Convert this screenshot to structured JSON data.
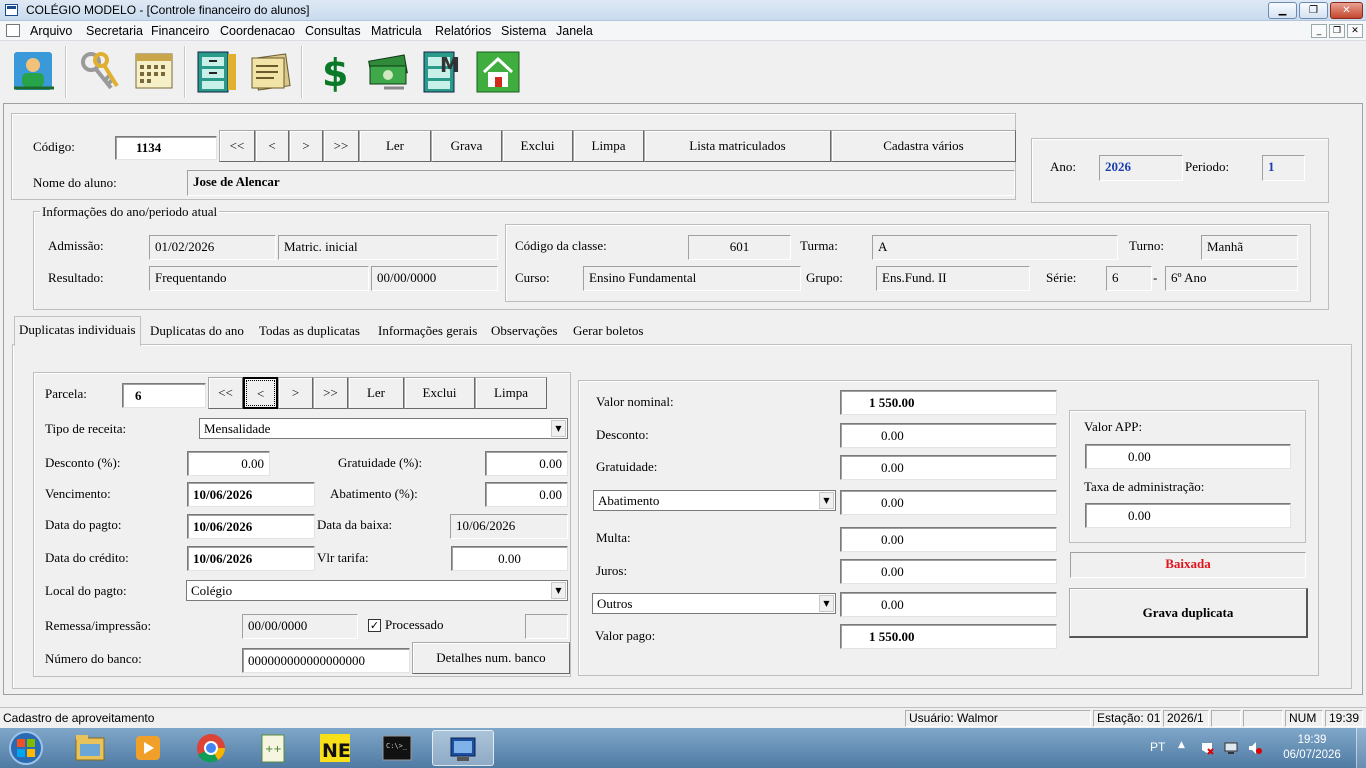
{
  "window": {
    "title": "COLÉGIO MODELO - [Controle financeiro do alunos]"
  },
  "menu": [
    "Arquivo",
    "Secretaria",
    "Financeiro",
    "Coordenacao",
    "Consultas",
    "Matricula",
    "Relatórios",
    "Sistema",
    "Janela"
  ],
  "student": {
    "codigo_label": "Código:",
    "codigo": "1134",
    "nav": [
      "<<",
      "<",
      ">",
      ">>"
    ],
    "actions": [
      "Ler",
      "Grava",
      "Exclui",
      "Limpa",
      "Lista matriculados",
      "Cadastra vários"
    ],
    "nome_label": "Nome do aluno:",
    "nome": "Jose de Alencar",
    "ano_label": "Ano:",
    "ano": "2026",
    "periodo_label": "Periodo:",
    "periodo": "1"
  },
  "ano_info": {
    "title": "Informações do ano/periodo atual",
    "admissao_label": "Admissão:",
    "admissao": "01/02/2026",
    "matric": "Matric. inicial",
    "resultado_label": "Resultado:",
    "resultado": "Frequentando",
    "resultado_data": "00/00/0000",
    "classe_label": "Código da classe:",
    "classe": "601",
    "turma_label": "Turma:",
    "turma": "A",
    "turno_label": "Turno:",
    "turno": "Manhã",
    "curso_label": "Curso:",
    "curso": "Ensino Fundamental",
    "grupo_label": "Grupo:",
    "grupo": "Ens.Fund. II",
    "serie_label": "Série:",
    "serie": "6",
    "serie_dash": "-",
    "serie_nome": "6º Ano"
  },
  "tabs": [
    "Duplicatas individuais",
    "Duplicatas do ano",
    "Todas as duplicatas",
    "Informações gerais",
    "Observações",
    "Gerar boletos"
  ],
  "dup": {
    "parcela_label": "Parcela:",
    "parcela": "6",
    "nav": [
      "<<",
      "<",
      ">",
      ">>"
    ],
    "actions": [
      "Ler",
      "Exclui",
      "Limpa"
    ],
    "tipo_label": "Tipo de receita:",
    "tipo": "Mensalidade",
    "desconto_label": "Desconto (%):",
    "desconto": "0.00",
    "gratuidade_label": "Gratuidade (%):",
    "gratuidade": "0.00",
    "vencimento_label": "Vencimento:",
    "vencimento": "10/06/2026",
    "abatimento_label": "Abatimento (%):",
    "abatimento": "0.00",
    "pagto_label": "Data do pagto:",
    "pagto": "10/06/2026",
    "baixa_label": "Data da baixa:",
    "baixa": "10/06/2026",
    "credito_label": "Data do crédito:",
    "credito": "10/06/2026",
    "tarifa_label": "Vlr tarifa:",
    "tarifa": "0.00",
    "local_label": "Local do pagto:",
    "local": "Colégio",
    "remessa_label": "Remessa/impressão:",
    "remessa": "00/00/0000",
    "processado_label": "Processado",
    "banco_label": "Número do banco:",
    "banco": "000000000000000000",
    "detalhes_label": "Detalhes num. banco"
  },
  "valores": {
    "nominal_label": "Valor nominal:",
    "nominal": "1 550.00",
    "desconto_label": "Desconto:",
    "desconto": "0.00",
    "gratuidade_label": "Gratuidade:",
    "gratuidade": "0.00",
    "abatimento_select": "Abatimento",
    "abatimento": "0.00",
    "multa_label": "Multa:",
    "multa": "0.00",
    "juros_label": "Juros:",
    "juros": "0.00",
    "outros_select": "Outros",
    "outros": "0.00",
    "pago_label": "Valor pago:",
    "pago": "1 550.00",
    "app_label": "Valor APP:",
    "app": "0.00",
    "taxa_label": "Taxa de administração:",
    "taxa": "0.00",
    "status": "Baixada",
    "status_color": "#e0141e",
    "grava_label": "Grava duplicata"
  },
  "statusbar": {
    "message": "Cadastro de aproveitamento",
    "usuario": "Usuário: Walmor",
    "estacao": "Estação: 01",
    "periodo": "2026/1",
    "num": "NUM",
    "hora": "19:39"
  },
  "taskbar": {
    "lang": "PT",
    "time": "19:39",
    "date": "06/07/2026",
    "apps": [
      "explorer-icon",
      "media-player-icon",
      "chrome-icon",
      "notepadpp-icon",
      "nero-icon",
      "cmd-icon",
      "school-app-icon"
    ]
  },
  "colors": {
    "accent_blue": "#1a3fb0",
    "status_red": "#e0141e"
  }
}
